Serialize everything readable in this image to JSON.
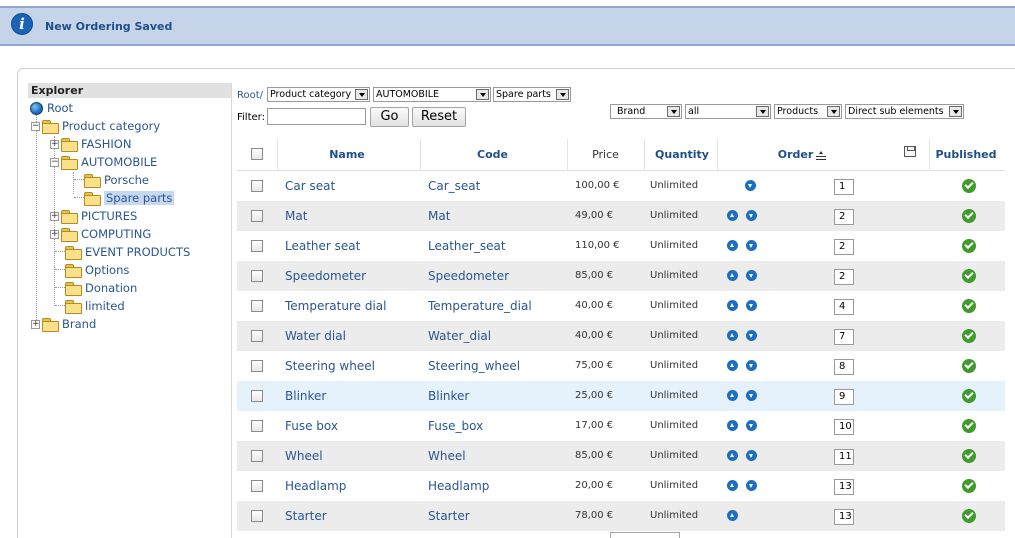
{
  "message": {
    "text": "New Ordering Saved",
    "icon": "info-icon"
  },
  "explorer": {
    "title": "Explorer",
    "root": "Root",
    "nodes": {
      "product_category": "Product category",
      "fashion": "FASHION",
      "automobile": "AUTOMOBILE",
      "porsche": "Porsche",
      "spare_parts": "Spare parts",
      "pictures": "PICTURES",
      "computing": "COMPUTING",
      "event_products": "EVENT PRODUCTS",
      "options": "Options",
      "donation": "Donation",
      "limited": "limited",
      "brand": "Brand"
    }
  },
  "toolbar": {
    "breadcrumb_root": "Root/",
    "category_select": "Product category",
    "automobile_select": "AUTOMOBILE",
    "spare_parts_select": "Spare parts",
    "filter_label": "Filter:",
    "filter_value": "",
    "go_label": "Go",
    "reset_label": "Reset",
    "brand_select": "Brand",
    "all_select": "all",
    "products_select": "Products",
    "direct_select": "Direct sub elements"
  },
  "table": {
    "headers": {
      "name": "Name",
      "code": "Code",
      "price": "Price",
      "quantity": "Quantity",
      "order": "Order",
      "published": "Published"
    },
    "rows": [
      {
        "name": "Car seat",
        "code": "Car_seat",
        "price": "100,00 €",
        "quantity": "Unlimited",
        "order": "1",
        "up": false,
        "down": true,
        "published": true
      },
      {
        "name": "Mat",
        "code": "Mat",
        "price": "49,00 €",
        "quantity": "Unlimited",
        "order": "2",
        "up": true,
        "down": true,
        "published": true
      },
      {
        "name": "Leather seat",
        "code": "Leather_seat",
        "price": "110,00 €",
        "quantity": "Unlimited",
        "order": "2",
        "up": true,
        "down": true,
        "published": true
      },
      {
        "name": "Speedometer",
        "code": "Speedometer",
        "price": "85,00 €",
        "quantity": "Unlimited",
        "order": "2",
        "up": true,
        "down": true,
        "published": true
      },
      {
        "name": "Temperature dial",
        "code": "Temperature_dial",
        "price": "40,00 €",
        "quantity": "Unlimited",
        "order": "4",
        "up": true,
        "down": true,
        "published": true
      },
      {
        "name": "Water dial",
        "code": "Water_dial",
        "price": "40,00 €",
        "quantity": "Unlimited",
        "order": "7",
        "up": true,
        "down": true,
        "published": true
      },
      {
        "name": "Steering wheel",
        "code": "Steering_wheel",
        "price": "75,00 €",
        "quantity": "Unlimited",
        "order": "8",
        "up": true,
        "down": true,
        "published": true
      },
      {
        "name": "Blinker",
        "code": "Blinker",
        "price": "25,00 €",
        "quantity": "Unlimited",
        "order": "9",
        "up": true,
        "down": true,
        "published": true
      },
      {
        "name": "Fuse box",
        "code": "Fuse_box",
        "price": "17,00 €",
        "quantity": "Unlimited",
        "order": "10",
        "up": true,
        "down": true,
        "published": true
      },
      {
        "name": "Wheel",
        "code": "Wheel",
        "price": "85,00 €",
        "quantity": "Unlimited",
        "order": "11",
        "up": true,
        "down": true,
        "published": true
      },
      {
        "name": "Headlamp",
        "code": "Headlamp",
        "price": "20,00 €",
        "quantity": "Unlimited",
        "order": "13",
        "up": true,
        "down": true,
        "published": true
      },
      {
        "name": "Starter",
        "code": "Starter",
        "price": "78,00 €",
        "quantity": "Unlimited",
        "order": "13",
        "up": true,
        "down": false,
        "published": true
      }
    ]
  },
  "colors": {
    "link": "#2a5590",
    "header_bar": "#c6d4e9",
    "published": "#3e9b2c",
    "row_alt": "#ececec",
    "row_highlight": "#e5f2fb"
  }
}
